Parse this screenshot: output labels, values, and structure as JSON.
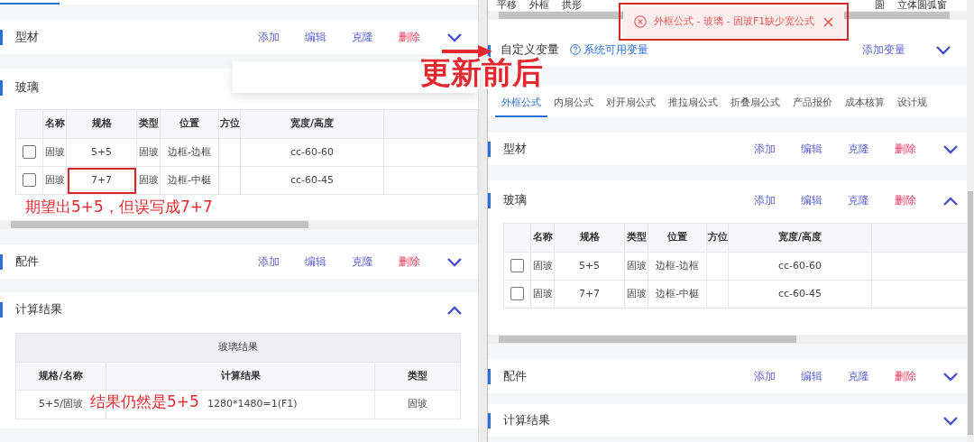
{
  "before_panel": {
    "blank_popup": true,
    "sections": [
      {
        "title": "型材",
        "expanded": false,
        "actions": [
          {
            "label": "添加",
            "kind": "add"
          },
          {
            "label": "编辑",
            "kind": "edit"
          },
          {
            "label": "克隆",
            "kind": "clone"
          },
          {
            "label": "删除",
            "kind": "delete"
          }
        ]
      },
      {
        "title": "玻璃",
        "table": {
          "columns": [
            "名称",
            "规格",
            "类型",
            "位置",
            "方位",
            "宽度/高度"
          ],
          "rows": [
            {
              "checked": false,
              "name": "固玻",
              "spec": "5+5",
              "type": "固玻",
              "position": "边框-边框",
              "width_height": "cc-60-60"
            },
            {
              "checked": false,
              "name": "固玻",
              "spec": "7+7",
              "type": "固玻",
              "position": "边框-中梃",
              "width_height": "cc-60-45",
              "spec_boxed": true
            }
          ]
        },
        "note": "期望出5+5，但误写成7+7"
      },
      {
        "title": "配件",
        "expanded": false,
        "actions": [
          {
            "label": "添加",
            "kind": "add"
          },
          {
            "label": "编辑",
            "kind": "edit"
          },
          {
            "label": "克隆",
            "kind": "clone"
          },
          {
            "label": "删除",
            "kind": "delete"
          }
        ]
      },
      {
        "title": "计算结果",
        "expanded": true,
        "results": {
          "caption": "玻璃结果",
          "columns": [
            "规格/名称",
            "计算结果",
            "类型"
          ],
          "rows": [
            [
              "5+5/固玻",
              "1280*1480=1(F1)",
              "固玻"
            ]
          ]
        },
        "note": "结果仍然是5+5"
      }
    ]
  },
  "comparison_note": "更新前后",
  "after_panel": {
    "shape_tools_left": [
      "平移",
      "外框",
      "拱形"
    ],
    "shape_tools_right": [
      "圆",
      "立体圆弧窗"
    ],
    "toast": {
      "message": "外框公式 - 玻璃 - 固玻F1缺少宽公式",
      "outlined": true
    },
    "variables": {
      "title": "自定义变量",
      "help_link": "系统可用变量",
      "add_label": "添加变量",
      "expanded": false
    },
    "tabs": [
      {
        "label": "外框公式",
        "selected": true
      },
      {
        "label": "内扇公式",
        "selected": false
      },
      {
        "label": "对开扇公式",
        "selected": false
      },
      {
        "label": "推拉扇公式",
        "selected": false
      },
      {
        "label": "折叠扇公式",
        "selected": false
      },
      {
        "label": "产品报价",
        "selected": false
      },
      {
        "label": "成本核算",
        "selected": false
      },
      {
        "label": "设计规",
        "selected": false
      }
    ],
    "sections": [
      {
        "title": "型材",
        "expanded": false,
        "actions": [
          {
            "label": "添加",
            "kind": "add"
          },
          {
            "label": "编辑",
            "kind": "edit"
          },
          {
            "label": "克隆",
            "kind": "clone"
          },
          {
            "label": "删除",
            "kind": "delete"
          }
        ]
      },
      {
        "title": "玻璃",
        "expanded": true,
        "actions": [
          {
            "label": "添加",
            "kind": "add"
          },
          {
            "label": "编辑",
            "kind": "edit"
          },
          {
            "label": "克隆",
            "kind": "clone"
          },
          {
            "label": "删除",
            "kind": "delete"
          }
        ],
        "table": {
          "columns": [
            "名称",
            "规格",
            "类型",
            "位置",
            "方位",
            "宽度/高度"
          ],
          "rows": [
            {
              "checked": false,
              "name": "固玻",
              "spec": "5+5",
              "type": "固玻",
              "position": "边框-边框",
              "width_height": "cc-60-60"
            },
            {
              "checked": false,
              "name": "固玻",
              "spec": "7+7",
              "type": "固玻",
              "position": "边框-中梃",
              "width_height": "cc-60-45"
            }
          ]
        }
      },
      {
        "title": "配件",
        "expanded": false,
        "actions": [
          {
            "label": "添加",
            "kind": "add"
          },
          {
            "label": "编辑",
            "kind": "edit"
          },
          {
            "label": "克隆",
            "kind": "clone"
          },
          {
            "label": "删除",
            "kind": "delete"
          }
        ]
      },
      {
        "title": "计算结果",
        "expanded": false
      }
    ]
  }
}
